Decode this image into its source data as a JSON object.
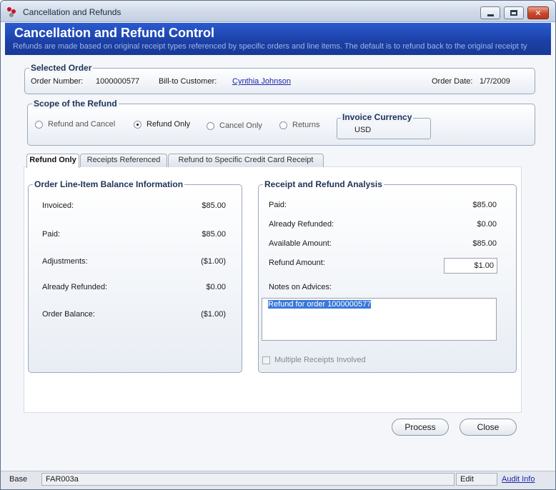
{
  "window": {
    "title": "Cancellation and Refunds",
    "close_glyph": "✕"
  },
  "header": {
    "title": "Cancellation and Refund Control",
    "subtitle": "Refunds are made based on original receipt types referenced by specific orders and line items. The default is to refund back to the original receipt ty"
  },
  "selected_order": {
    "legend": "Selected Order",
    "order_number_label": "Order Number:",
    "order_number": "1000000577",
    "customer_label": "Bill-to Customer:",
    "customer_name": "Cynthia Johnson",
    "order_date_label": "Order Date:",
    "order_date": "1/7/2009"
  },
  "scope": {
    "legend": "Scope of the Refund",
    "options": [
      {
        "label": "Refund and Cancel",
        "checked": false
      },
      {
        "label": "Refund Only",
        "checked": true
      },
      {
        "label": "Cancel Only",
        "checked": false
      },
      {
        "label": "Returns",
        "checked": false
      }
    ],
    "currency_legend": "Invoice Currency",
    "currency": "USD"
  },
  "tabs": [
    {
      "label": "Refund Only",
      "active": true
    },
    {
      "label": "Receipts Referenced",
      "active": false
    },
    {
      "label": "Refund to Specific Credit Card Receipt",
      "active": false
    }
  ],
  "balance_info": {
    "legend": "Order Line-Item Balance Information",
    "rows": [
      {
        "label": "Invoiced:",
        "value": "$85.00"
      },
      {
        "label": "Paid:",
        "value": "$85.00"
      },
      {
        "label": "Adjustments:",
        "value": "($1.00)"
      },
      {
        "label": "Already Refunded:",
        "value": "$0.00"
      },
      {
        "label": "Order Balance:",
        "value": "($1.00)"
      }
    ]
  },
  "refund_analysis": {
    "legend": "Receipt and Refund Analysis",
    "rows": [
      {
        "label": "Paid:",
        "value": "$85.00"
      },
      {
        "label": "Already Refunded:",
        "value": "$0.00"
      },
      {
        "label": "Available Amount:",
        "value": "$85.00"
      }
    ],
    "refund_amount_label": "Refund Amount:",
    "refund_amount": "$1.00",
    "notes_label": "Notes on Advices:",
    "notes_text": "Refund for order 1000000577",
    "multiple_receipts_label": "Multiple Receipts Involved"
  },
  "buttons": {
    "process": "Process",
    "close": "Close"
  },
  "statusbar": {
    "base": "Base",
    "form_id": "FAR003a",
    "mode": "Edit",
    "audit_link": "Audit Info"
  },
  "colors": {
    "banner": "#1b3fa4",
    "link": "#1a27a8",
    "selection": "#3a78d8",
    "close_button": "#c9472c"
  }
}
